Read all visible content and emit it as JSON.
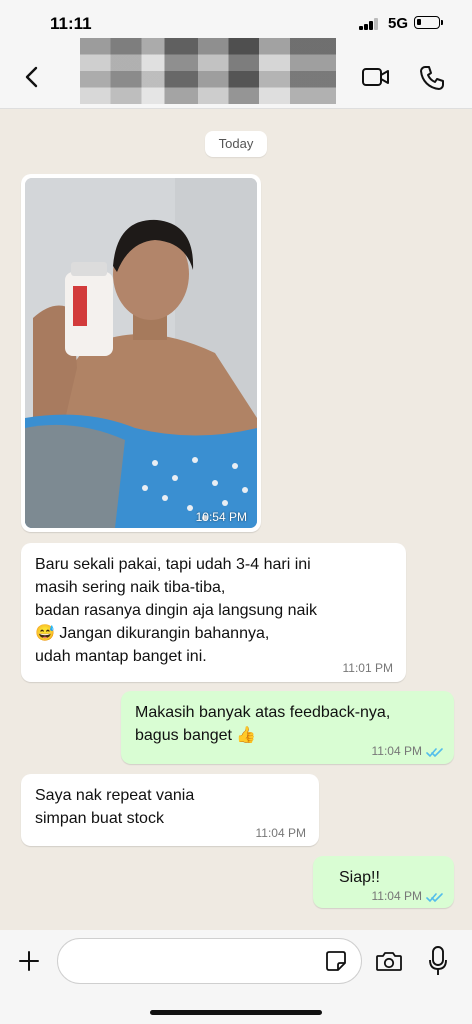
{
  "status_bar": {
    "time": "11:11",
    "network": "5G"
  },
  "chat": {
    "date_label": "Today",
    "messages": [
      {
        "type": "image",
        "direction": "in",
        "time": "10:54 PM"
      },
      {
        "type": "text",
        "direction": "in",
        "text": "Baru sekali pakai, tapi udah 3-4 hari ini\nmasih sering naik tiba-tiba,\nbadan rasanya dingin aja langsung naik\n😅 Jangan dikurangin bahannya,\nudah mantap banget ini.",
        "time": "11:01 PM"
      },
      {
        "type": "text",
        "direction": "out",
        "text": "Makasih banyak atas feedback-nya,\nbagus banget 👍",
        "time": "11:04 PM"
      },
      {
        "type": "text",
        "direction": "in",
        "text": "Saya nak repeat vania\nsimpan buat stock",
        "time": "11:04 PM"
      },
      {
        "type": "text",
        "direction": "out",
        "text": "Siap!!",
        "time": "11:04 PM"
      }
    ]
  },
  "icons": {
    "back": "chevron-left-icon",
    "video": "video-camera-icon",
    "call": "phone-icon",
    "plus": "plus-icon",
    "sticker": "sticker-icon",
    "camera": "camera-icon",
    "mic": "microphone-icon",
    "read_receipt": "double-check-icon"
  },
  "colors": {
    "chat_background": "#efeae2",
    "incoming_bubble": "#ffffff",
    "outgoing_bubble": "#d9fdd3",
    "read_tick": "#53bdeb"
  }
}
